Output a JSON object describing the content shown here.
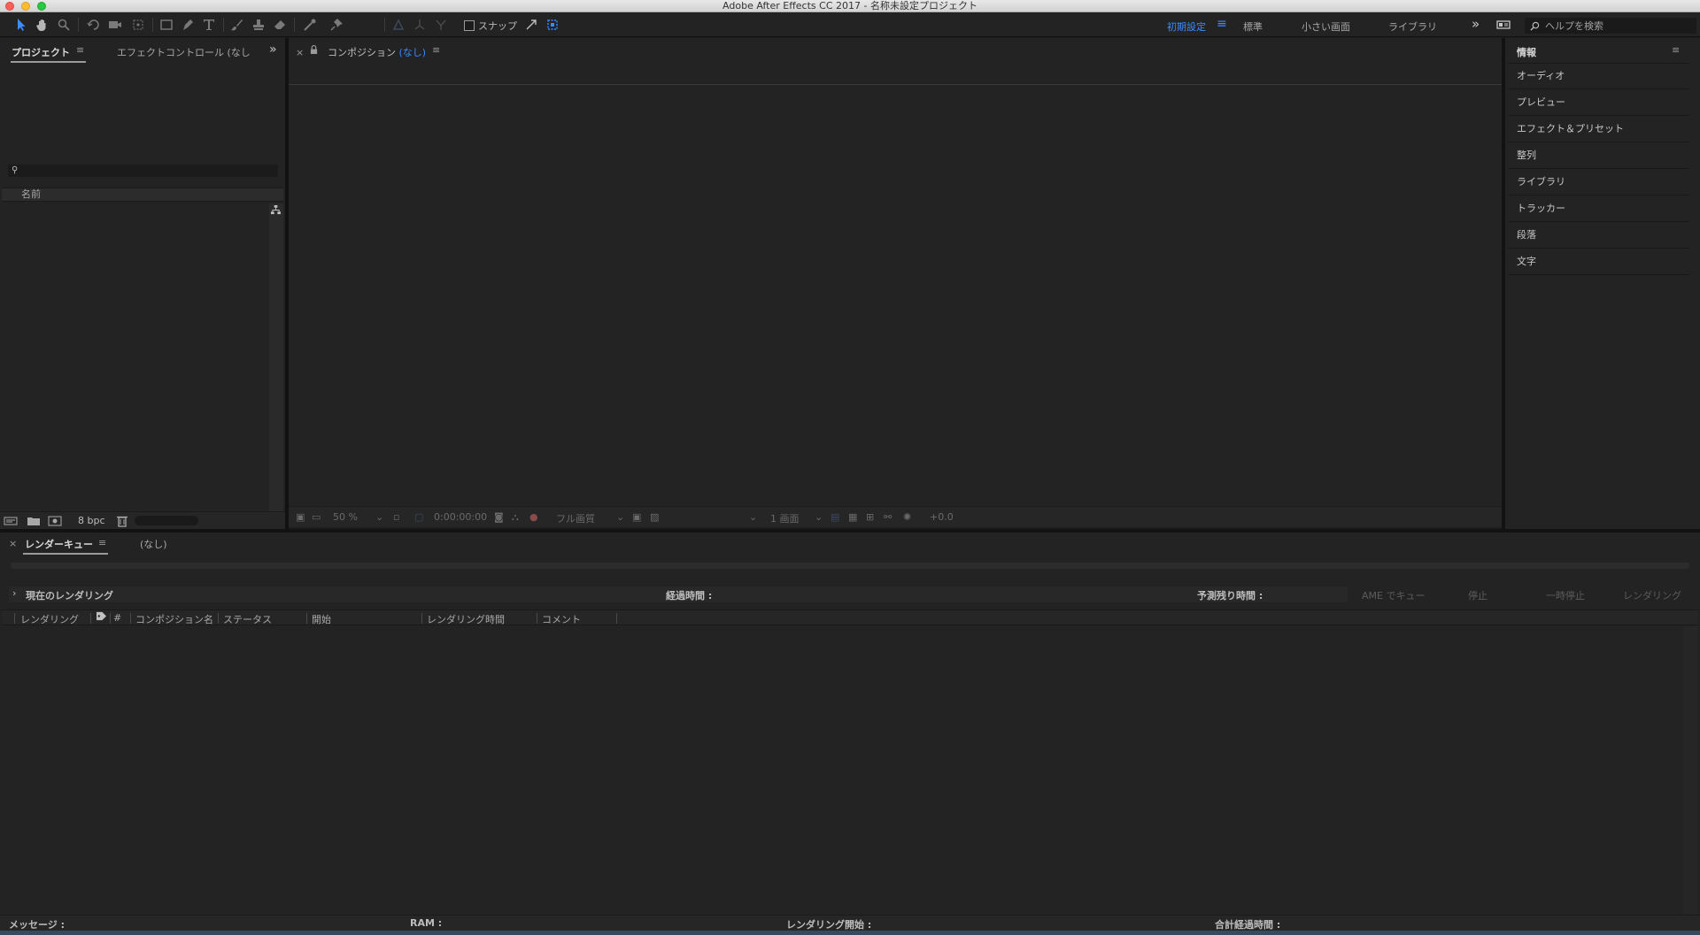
{
  "window": {
    "title": "Adobe After Effects CC 2017 - 名称未設定プロジェクト"
  },
  "toolbar": {
    "snap_label": "スナップ",
    "workspaces": [
      {
        "label": "初期設定",
        "active": true
      },
      {
        "label": "標準",
        "active": false
      },
      {
        "label": "小さい画面",
        "active": false
      },
      {
        "label": "ライブラリ",
        "active": false
      }
    ],
    "help_placeholder": "ヘルプを検索",
    "accent_color": "#3b8cff"
  },
  "project_panel": {
    "tab_project": "プロジェクト",
    "tab_effect_controls": "エフェクトコントロール (なし",
    "search_value": "",
    "column_name": "名前",
    "bit_depth": "8 bpc"
  },
  "composition_panel": {
    "tab_prefix": "コンポジション",
    "tab_value": "(なし)",
    "zoom": "50 %",
    "timecode": "0:00:00:00",
    "resolution": "フル画質",
    "views": "1 画面",
    "exposure": "+0.0"
  },
  "right_panel": {
    "items": [
      "情報",
      "オーディオ",
      "プレビュー",
      "エフェクト＆プリセット",
      "整列",
      "ライブラリ",
      "トラッカー",
      "段落",
      "文字"
    ]
  },
  "render_queue": {
    "tab_label": "レンダーキュー",
    "tab_none": "(なし)",
    "current_render": "現在のレンダリング",
    "elapsed_label": "経過時間 :",
    "remaining_label": "予測残り時間 :",
    "buttons": [
      "AME でキュー",
      "停止",
      "一時停止",
      "レンダリング"
    ],
    "columns": [
      "レンダリング",
      "#",
      "コンポジション名",
      "ステータス",
      "開始",
      "レンダリング時間",
      "コメント"
    ]
  },
  "status_bar": {
    "message": "メッセージ :",
    "ram": "RAM :",
    "render_start": "レンダリング開始 :",
    "total_elapsed": "合計経過時間 :"
  }
}
